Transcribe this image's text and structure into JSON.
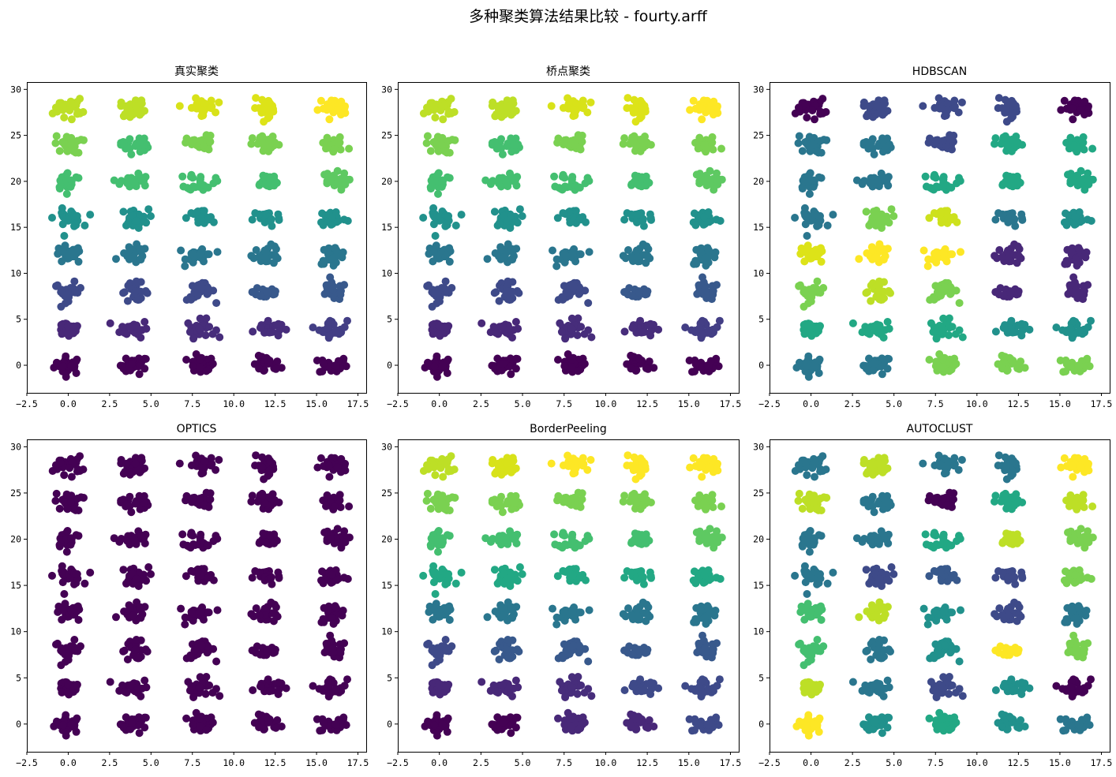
{
  "figure": {
    "title": "多种聚类算法结果比较 - fourty.arff"
  },
  "chart_data": {
    "type": "scatter",
    "dataset": "fourty.arff",
    "grid": false,
    "colormap": "viridis",
    "xlim": [
      -2.5,
      18
    ],
    "ylim": [
      -3,
      30.8
    ],
    "xticks": [
      -2.5,
      0,
      2.5,
      5,
      7.5,
      10,
      12.5,
      15,
      17.5
    ],
    "xtick_labels": [
      "−2.5",
      "0.0",
      "2.5",
      "5.0",
      "7.5",
      "10.0",
      "12.5",
      "15.0",
      "17.5"
    ],
    "yticks": [
      0,
      5,
      10,
      15,
      20,
      25,
      30
    ],
    "ytick_labels": [
      "0",
      "5",
      "10",
      "15",
      "20",
      "25",
      "30"
    ],
    "cluster_grid": {
      "columns_x": [
        0.0,
        4.0,
        8.0,
        12.0,
        16.0
      ],
      "rows_y": [
        0.0,
        4.0,
        8.0,
        12.0,
        16.0,
        20.0,
        24.0,
        28.0
      ]
    },
    "panels": [
      {
        "title": "真实聚类",
        "label_colors": [
          [
            "#440154",
            "#440154",
            "#440154",
            "#440154",
            "#440154"
          ],
          [
            "#482878",
            "#482878",
            "#472d7b",
            "#472d7b",
            "#433e85"
          ],
          [
            "#3e4a89",
            "#3e4a89",
            "#3e4a89",
            "#38598c",
            "#38598c"
          ],
          [
            "#2a768e",
            "#2a768e",
            "#2a768e",
            "#2a768e",
            "#2a768e"
          ],
          [
            "#21918c",
            "#21918c",
            "#21918c",
            "#21918c",
            "#21918c"
          ],
          [
            "#44bf70",
            "#44bf70",
            "#44bf70",
            "#44bf70",
            "#5ec962"
          ],
          [
            "#7ad151",
            "#44bf70",
            "#7ad151",
            "#7ad151",
            "#7ad151"
          ],
          [
            "#bddf26",
            "#bddf26",
            "#d8e219",
            "#dde318",
            "#fde725"
          ]
        ]
      },
      {
        "title": "桥点聚类",
        "label_colors": [
          [
            "#440154",
            "#440154",
            "#440154",
            "#440154",
            "#440154"
          ],
          [
            "#482878",
            "#482878",
            "#472d7b",
            "#472d7b",
            "#433e85"
          ],
          [
            "#3e4a89",
            "#3e4a89",
            "#3e4a89",
            "#38598c",
            "#38598c"
          ],
          [
            "#2a768e",
            "#2a768e",
            "#2a768e",
            "#2a768e",
            "#2a768e"
          ],
          [
            "#21918c",
            "#21918c",
            "#21918c",
            "#21918c",
            "#21918c"
          ],
          [
            "#44bf70",
            "#44bf70",
            "#44bf70",
            "#44bf70",
            "#5ec962"
          ],
          [
            "#7ad151",
            "#44bf70",
            "#7ad151",
            "#7ad151",
            "#7ad151"
          ],
          [
            "#bddf26",
            "#bddf26",
            "#d8e219",
            "#dde318",
            "#fde725"
          ]
        ]
      },
      {
        "title": "HDBSCAN",
        "label_colors": [
          [
            "#2a768e",
            "#2a768e",
            "#7ad151",
            "#7ad151",
            "#7ad151"
          ],
          [
            "#22a884",
            "#22a884",
            "#22a884",
            "#21918c",
            "#21918c"
          ],
          [
            "#7ad151",
            "#bddf26",
            "#7ad151",
            "#482878",
            "#482878"
          ],
          [
            "#dde318",
            "#fde725",
            "#fde725",
            "#482878",
            "#482878"
          ],
          [
            "#2a768e",
            "#7ad151",
            "#cde11d",
            "#2a768e",
            "#21918c"
          ],
          [
            "#2a768e",
            "#2a768e",
            "#22a884",
            "#22a884",
            "#22a884"
          ],
          [
            "#2a768e",
            "#2a768e",
            "#3e4a89",
            "#22a884",
            "#22a884"
          ],
          [
            "#440154",
            "#3e4a89",
            "#3e4a89",
            "#3e4a89",
            "#440154"
          ]
        ]
      },
      {
        "title": "OPTICS",
        "label_colors": [
          [
            "#440154",
            "#440154",
            "#440154",
            "#440154",
            "#440154"
          ],
          [
            "#440154",
            "#440154",
            "#440154",
            "#440154",
            "#440154"
          ],
          [
            "#440154",
            "#440154",
            "#440154",
            "#440154",
            "#440154"
          ],
          [
            "#440154",
            "#440154",
            "#440154",
            "#440154",
            "#440154"
          ],
          [
            "#440154",
            "#440154",
            "#440154",
            "#440154",
            "#440154"
          ],
          [
            "#440154",
            "#440154",
            "#440154",
            "#440154",
            "#440154"
          ],
          [
            "#440154",
            "#440154",
            "#440154",
            "#440154",
            "#440154"
          ],
          [
            "#440154",
            "#440154",
            "#440154",
            "#440154",
            "#440154"
          ]
        ]
      },
      {
        "title": "BorderPeeling",
        "label_colors": [
          [
            "#440154",
            "#440154",
            "#482878",
            "#482878",
            "#3e4a89"
          ],
          [
            "#482878",
            "#482878",
            "#472d7b",
            "#3e4a89",
            "#3e4a89"
          ],
          [
            "#3e4a89",
            "#38598c",
            "#38598c",
            "#38598c",
            "#38598c"
          ],
          [
            "#2a768e",
            "#2a768e",
            "#2a768e",
            "#2a768e",
            "#2a768e"
          ],
          [
            "#22a884",
            "#22a884",
            "#22a884",
            "#22a884",
            "#22a884"
          ],
          [
            "#44bf70",
            "#44bf70",
            "#44bf70",
            "#44bf70",
            "#5ec962"
          ],
          [
            "#7ad151",
            "#7ad151",
            "#7ad151",
            "#7ad151",
            "#7ad151"
          ],
          [
            "#bddf26",
            "#d8e219",
            "#fde725",
            "#fde725",
            "#fde725"
          ]
        ]
      },
      {
        "title": "AUTOCLUST",
        "label_colors": [
          [
            "#fde725",
            "#21918c",
            "#22a884",
            "#21918c",
            "#2a768e"
          ],
          [
            "#bddf26",
            "#2a768e",
            "#3e4a89",
            "#21918c",
            "#440154"
          ],
          [
            "#44bf70",
            "#2a768e",
            "#21918c",
            "#fde725",
            "#7ad151"
          ],
          [
            "#44bf70",
            "#bddf26",
            "#21918c",
            "#3e4a89",
            "#2a768e"
          ],
          [
            "#2a768e",
            "#3e4a89",
            "#38598c",
            "#3e4a89",
            "#7ad151"
          ],
          [
            "#2a768e",
            "#2a768e",
            "#22a884",
            "#bddf26",
            "#7ad151"
          ],
          [
            "#bddf26",
            "#2a768e",
            "#440154",
            "#22a884",
            "#bddf26"
          ],
          [
            "#2a768e",
            "#bddf26",
            "#2a768e",
            "#2a768e",
            "#fde725"
          ]
        ]
      }
    ]
  }
}
